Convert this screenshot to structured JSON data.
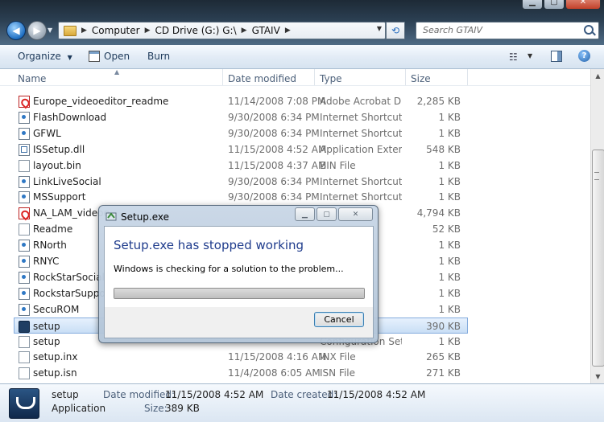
{
  "toolbar": {
    "breadcrumb": [
      "Computer",
      "CD Drive (G:) G:\\",
      "GTAIV"
    ],
    "search_placeholder": "Search GTAIV",
    "commands": {
      "organize": "Organize",
      "open": "Open",
      "burn": "Burn"
    }
  },
  "columns": {
    "name": "Name",
    "date": "Date modified",
    "type": "Type",
    "size": "Size"
  },
  "files": [
    {
      "name": "Europe_videoeditor_readme",
      "date": "11/14/2008 7:08 PM",
      "type": "Adobe Acrobat D...",
      "size": "2,285 KB",
      "icon": "pdf-icon"
    },
    {
      "name": "FlashDownload",
      "date": "9/30/2008 6:34 PM",
      "type": "Internet Shortcut",
      "size": "1 KB",
      "icon": "url-icon"
    },
    {
      "name": "GFWL",
      "date": "9/30/2008 6:34 PM",
      "type": "Internet Shortcut",
      "size": "1 KB",
      "icon": "url-icon"
    },
    {
      "name": "ISSetup.dll",
      "date": "11/15/2008 4:52 AM",
      "type": "Application Extens...",
      "size": "548 KB",
      "icon": "dll-icon"
    },
    {
      "name": "layout.bin",
      "date": "11/15/2008 4:37 AM",
      "type": "BIN File",
      "size": "1 KB",
      "icon": "file-icon"
    },
    {
      "name": "LinkLiveSocial",
      "date": "9/30/2008 6:34 PM",
      "type": "Internet Shortcut",
      "size": "1 KB",
      "icon": "url-icon"
    },
    {
      "name": "MSSupport",
      "date": "9/30/2008 6:34 PM",
      "type": "Internet Shortcut",
      "size": "1 KB",
      "icon": "url-icon"
    },
    {
      "name": "NA_LAM_videoe",
      "date": "",
      "type": "t D...",
      "size": "4,794 KB",
      "icon": "pdf-icon"
    },
    {
      "name": "Readme",
      "date": "",
      "type": "",
      "size": "52 KB",
      "icon": "file-icon"
    },
    {
      "name": "RNorth",
      "date": "",
      "type": "ut",
      "size": "1 KB",
      "icon": "url-icon"
    },
    {
      "name": "RNYC",
      "date": "",
      "type": "ut",
      "size": "1 KB",
      "icon": "url-icon"
    },
    {
      "name": "RockStarSocialC",
      "date": "",
      "type": "ut",
      "size": "1 KB",
      "icon": "url-icon"
    },
    {
      "name": "RockstarSupport",
      "date": "",
      "type": "ut",
      "size": "1 KB",
      "icon": "url-icon"
    },
    {
      "name": "SecuROM",
      "date": "",
      "type": "ut",
      "size": "1 KB",
      "icon": "url-icon"
    },
    {
      "name": "setup",
      "date": "",
      "type": "",
      "size": "390 KB",
      "icon": "setup-icon",
      "selected": true
    },
    {
      "name": "setup",
      "date": "",
      "type": "Configuration Sett...",
      "size": "1 KB",
      "icon": "settings-file-icon"
    },
    {
      "name": "setup.inx",
      "date": "11/15/2008 4:16 AM",
      "type": "INX File",
      "size": "265 KB",
      "icon": "file-icon"
    },
    {
      "name": "setup.isn",
      "date": "11/4/2008 6:05 AM",
      "type": "ISN File",
      "size": "271 KB",
      "icon": "file-icon"
    }
  ],
  "details": {
    "name": "setup",
    "kind": "Application",
    "modified_label": "Date modified:",
    "modified_value": "11/15/2008 4:52 AM",
    "created_label": "Date created:",
    "created_value": "11/15/2008 4:52 AM",
    "size_label": "Size:",
    "size_value": "389 KB"
  },
  "dialog": {
    "title": "Setup.exe",
    "heading": "Setup.exe has stopped working",
    "message": "Windows is checking for a solution to the problem...",
    "progress": 1.0,
    "cancel": "Cancel"
  }
}
